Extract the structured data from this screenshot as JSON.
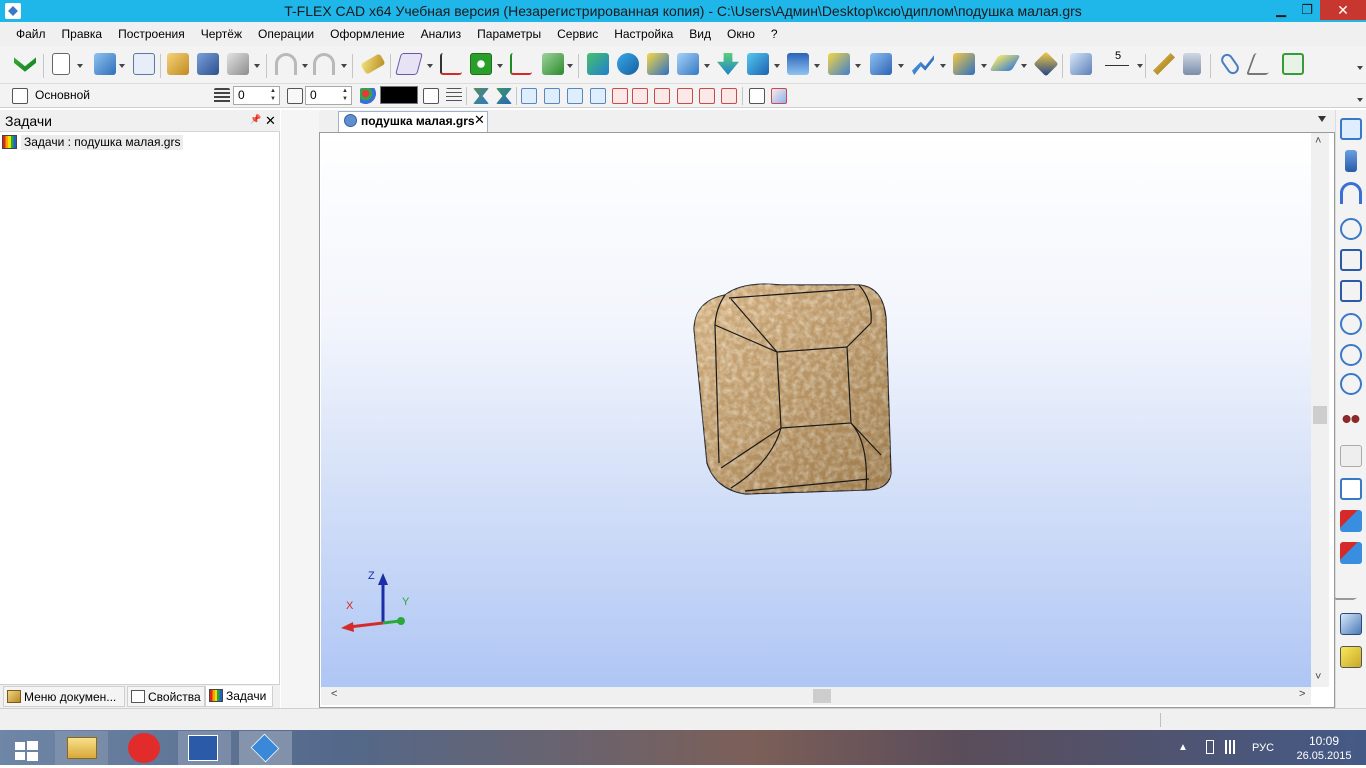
{
  "window": {
    "title": "T-FLEX CAD x64 Учебная версия (Незарегистрированная копия) - C:\\Users\\Админ\\Desktop\\ксю\\диплом\\подушка малая.grs",
    "minimize": "▁",
    "maximize": "❐",
    "close": "✕"
  },
  "menu": {
    "items": [
      "Файл",
      "Правка",
      "Построения",
      "Чертёж",
      "Операции",
      "Оформление",
      "Анализ",
      "Параметры",
      "Сервис",
      "Настройка",
      "Вид",
      "Окно",
      "?"
    ]
  },
  "toolbar2": {
    "style_label": "Основной",
    "layer_value": "0",
    "level_value": "0",
    "dimension_value": "5"
  },
  "left_panel": {
    "title": "Задачи",
    "pin": "📌",
    "close": "✕",
    "tree_item": "Задачи : подушка малая.grs",
    "tabs": [
      "Меню докумен...",
      "Свойства",
      "Задачи"
    ]
  },
  "document": {
    "tab_label": "подушка малая.grs",
    "tab_close": "✕"
  },
  "axes": {
    "x_label": "X",
    "y_label": "Y",
    "z_label": "Z"
  },
  "taskbar": {
    "language": "РУС",
    "time": "10:09",
    "date": "26.05.2015"
  },
  "colors": {
    "title_bar": "#1fb7ea",
    "close_button": "#c7372f",
    "pillow": "#c99a5c",
    "axis_x": "#d42a2a",
    "axis_y": "#2aa83a",
    "axis_z": "#1a2ea8"
  }
}
